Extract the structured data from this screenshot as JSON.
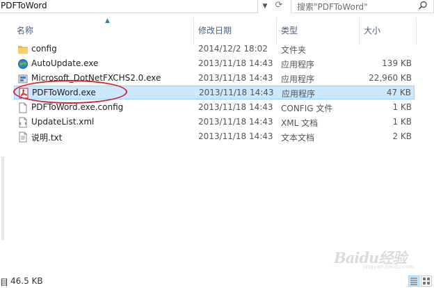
{
  "address": {
    "path": "PDFToWord",
    "dropdown_icon": "chevron-down-icon",
    "refresh_icon": "refresh-icon"
  },
  "search": {
    "placeholder": "搜索\"PDFToWord\"",
    "icon": "search-icon"
  },
  "columns": {
    "name": "名称",
    "date": "修改日期",
    "type": "类型",
    "size": "大小"
  },
  "files": [
    {
      "name": "config",
      "date": "2014/12/2 18:02",
      "type": "文件夹",
      "size": "",
      "icon": "folder-icon",
      "selected": false
    },
    {
      "name": "AutoUpdate.exe",
      "date": "2013/11/18 14:43",
      "type": "应用程序",
      "size": "139 KB",
      "icon": "globe-exe-icon",
      "selected": false
    },
    {
      "name": "Microsoft_DotNetFXCHS2.0.exe",
      "date": "2013/11/18 14:43",
      "type": "应用程序",
      "size": "22,960 KB",
      "icon": "installer-exe-icon",
      "selected": false
    },
    {
      "name": "PDFToWord.exe",
      "date": "2013/11/18 14:43",
      "type": "应用程序",
      "size": "47 KB",
      "icon": "pdf-exe-icon",
      "selected": true
    },
    {
      "name": "PDFToWord.exe.config",
      "date": "2013/11/18 14:43",
      "type": "CONFIG 文件",
      "size": "1 KB",
      "icon": "file-icon",
      "selected": false
    },
    {
      "name": "UpdateList.xml",
      "date": "2013/11/18 14:43",
      "type": "XML 文档",
      "size": "1 KB",
      "icon": "xml-file-icon",
      "selected": false
    },
    {
      "name": "说明.txt",
      "date": "2013/11/18 14:43",
      "type": "文本文档",
      "size": "2 KB",
      "icon": "text-file-icon",
      "selected": false
    }
  ],
  "status": {
    "count_fragment": "目",
    "selected_size": "46.5 KB"
  },
  "watermark": {
    "text": "Baidu经验",
    "sub": "jingyan.baidu.com"
  },
  "colors": {
    "selection": "#cce8ff",
    "selection_border": "#99d1ff",
    "annotation": "#d2232a",
    "header_text": "#4c607a"
  }
}
